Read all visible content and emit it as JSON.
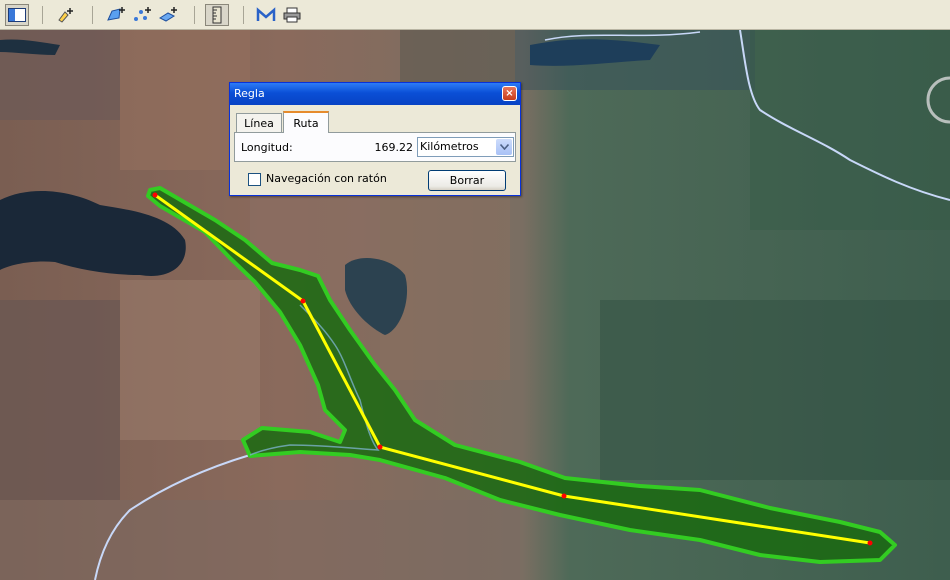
{
  "toolbar": {
    "icons": [
      "sidebar-toggle-icon",
      "add-placemark-icon",
      "add-polygon-icon",
      "add-path-icon",
      "add-overlay-icon",
      "ruler-icon",
      "email-icon",
      "print-icon"
    ]
  },
  "dialog": {
    "title": "Regla",
    "close_label": "×",
    "tabs": [
      {
        "label": "Línea",
        "selected": false
      },
      {
        "label": "Ruta",
        "selected": true
      }
    ],
    "length_label": "Longitud:",
    "length_value": "169.22",
    "unit_selected": "Kilómetros",
    "mouse_nav_label": "Navegación con ratón",
    "mouse_nav_checked": false,
    "clear_button": "Borrar"
  },
  "colors": {
    "path_line": "#ffff00",
    "buffer_fill": "#1a6a10",
    "buffer_outline": "#33cc22",
    "vertex": "#ff0000",
    "title_bar": "#0a4fd6"
  }
}
